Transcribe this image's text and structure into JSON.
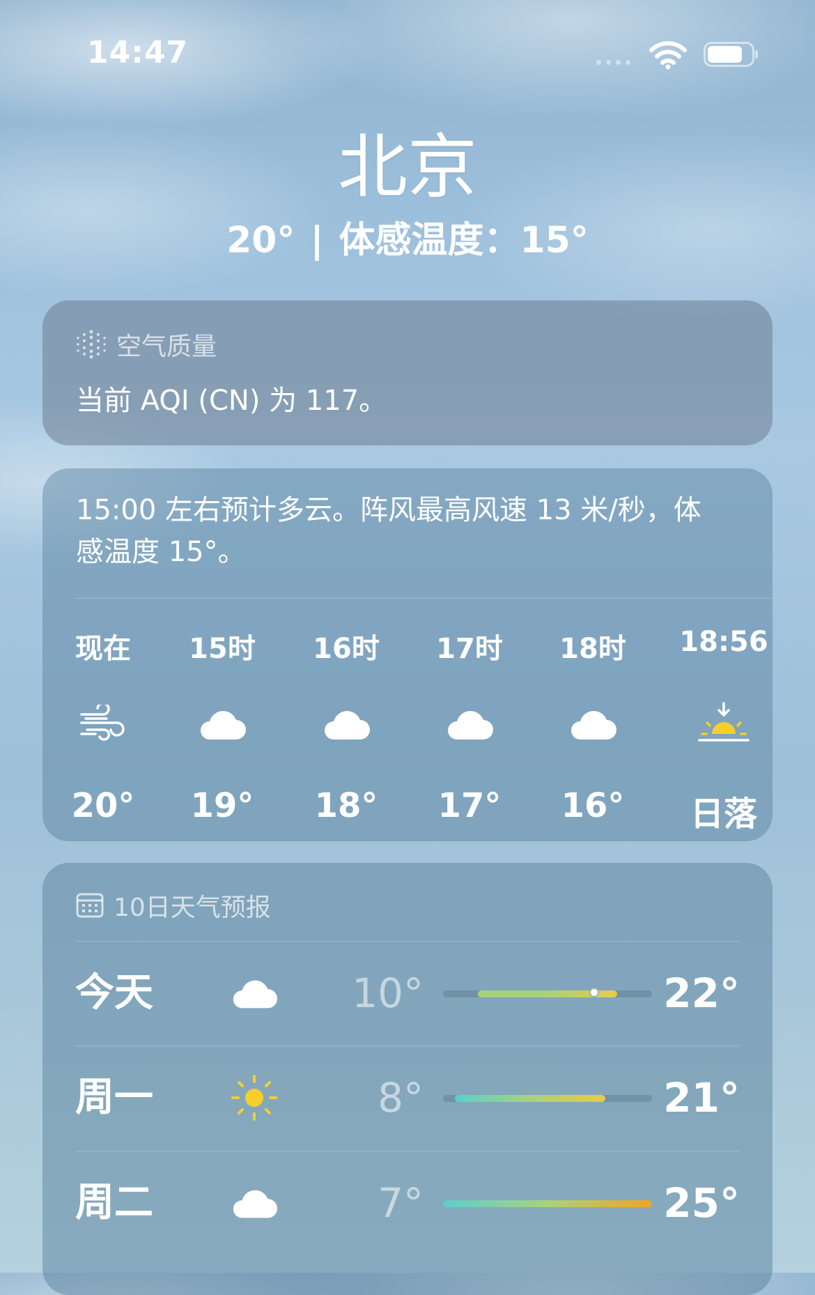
{
  "status_bar": {
    "time": "14:47"
  },
  "header": {
    "city": "北京",
    "current_temp": "20°",
    "separator": "|",
    "feels_like": "体感温度：15°"
  },
  "air_quality": {
    "title": "空气质量",
    "icon": "air-quality-dots-icon",
    "text": "当前 AQI (CN) 为 117。"
  },
  "hourly": {
    "summary": "15:00 左右预计多云。阵风最高风速 13 米/秒，体感温度 15°。",
    "items": [
      {
        "label": "现在",
        "icon": "wind-icon",
        "temp": "20°"
      },
      {
        "label": "15时",
        "icon": "cloud-icon",
        "temp": "19°"
      },
      {
        "label": "16时",
        "icon": "cloud-icon",
        "temp": "18°"
      },
      {
        "label": "17时",
        "icon": "cloud-icon",
        "temp": "17°"
      },
      {
        "label": "18时",
        "icon": "cloud-icon",
        "temp": "16°"
      },
      {
        "label": "18:56",
        "icon": "sunset-icon",
        "temp": "日落"
      }
    ]
  },
  "daily": {
    "title": "10日天气预报",
    "icon": "calendar-icon",
    "range": {
      "min": 7,
      "max": 25
    },
    "days": [
      {
        "day": "今天",
        "icon": "cloud-icon",
        "low": "10°",
        "high": "22°",
        "low_value": 10,
        "high_value": 22,
        "current_value": 20
      },
      {
        "day": "周一",
        "icon": "sun-icon",
        "low": "8°",
        "high": "21°",
        "low_value": 8,
        "high_value": 21
      },
      {
        "day": "周二",
        "icon": "cloud-icon",
        "low": "7°",
        "high": "25°",
        "low_value": 7,
        "high_value": 25
      }
    ]
  },
  "colors": {
    "sun": "#f6cf2c",
    "bar_cool": "#5ccfd0",
    "bar_mild": "#a8d27a",
    "bar_warm": "#e8cc43",
    "bar_hot": "#f2a422"
  }
}
